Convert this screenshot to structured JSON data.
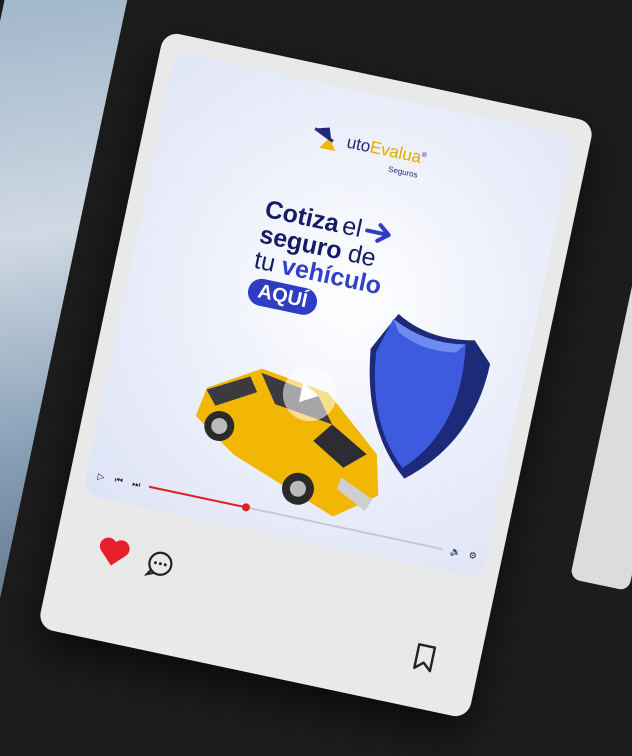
{
  "brand": {
    "prefix": "",
    "name_main": "uto",
    "name_highlight": "Evalua",
    "mark": "®",
    "subtitle": "Seguros"
  },
  "headline": {
    "line1_bold": "Cotiza",
    "line1_thin": "el",
    "line2_bold": "seguro",
    "line2_thin": "de",
    "line3_thin": "tu",
    "line3_bold": "vehículo",
    "badge": "AQUÍ"
  },
  "player": {
    "progress": 0.33
  },
  "icons": {
    "like": "heart-icon",
    "comment": "comment-icon",
    "save": "bookmark-icon",
    "play": "play-icon",
    "volume": "volume-icon",
    "settings": "gear-icon"
  },
  "colors": {
    "brand_blue": "#1f2a7a",
    "accent_blue": "#2f3cc4",
    "brand_yellow": "#e6a800",
    "like_red": "#e8202a",
    "progress_red": "#e02020"
  }
}
